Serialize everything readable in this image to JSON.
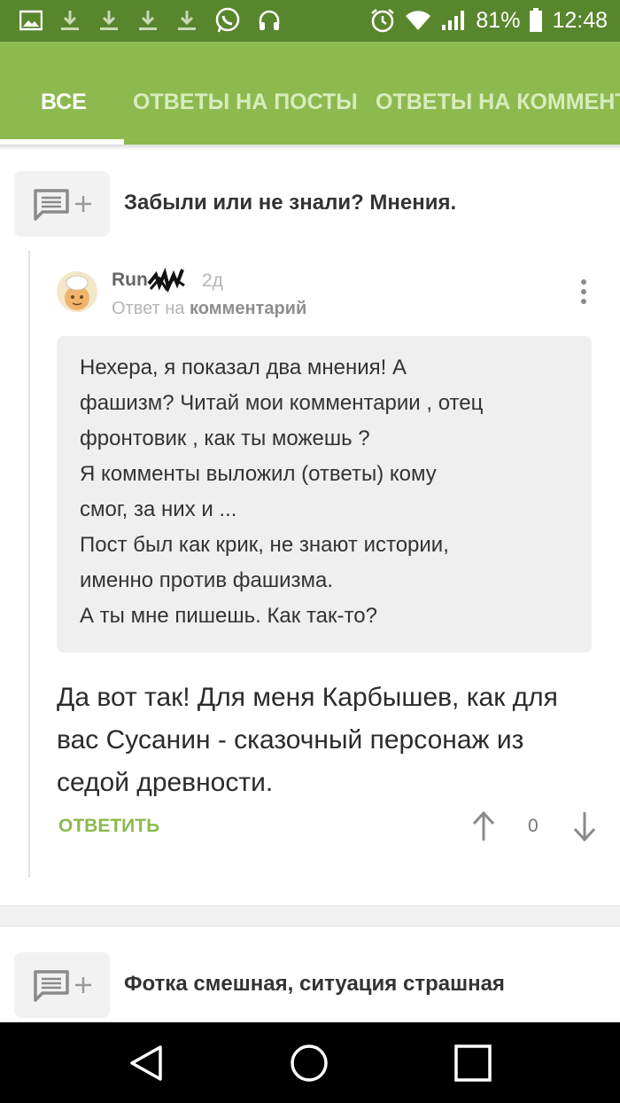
{
  "status_bar": {
    "left_icons": [
      "image-icon",
      "download-icon",
      "download-icon",
      "download-icon",
      "download-icon",
      "whatsapp-icon",
      "headphones-icon"
    ],
    "right_icons": [
      "alarm-icon",
      "wifi-icon",
      "signal-icon"
    ],
    "battery_percent": "81%",
    "time": "12:48"
  },
  "tabs": [
    {
      "label": "ВСЕ",
      "active": true
    },
    {
      "label": "ОТВЕТЫ НА ПОСТЫ",
      "active": false
    },
    {
      "label": "ОТВЕТЫ НА КОММЕНТАРИИ",
      "active": false
    }
  ],
  "posts": [
    {
      "title": "Забыли или не знали? Мнения."
    },
    {
      "title": "Фотка смешная, ситуация страшная"
    }
  ],
  "comment": {
    "username": "Run",
    "time_ago": "2д",
    "reply_prefix": "Ответ на",
    "reply_target": "комментарий",
    "quoted_lines": [
      "Нехера, я показал два мнения! А",
      "фашизм? Читай мои комментарии , отец",
      "фронтовик , как ты можешь ?",
      "Я комменты выложил (ответы) кому",
      "смог, за них и ...",
      "Пост был как крик, не знают истории,",
      "именно против фашизма.",
      "А ты мне пишешь. Как так-то?"
    ],
    "body_lines": [
      "Да вот так! Для меня Карбышев, как для",
      "вас Сусанин - сказочный персонаж из",
      "седой древности."
    ],
    "reply_label": "ОТВЕТИТЬ",
    "rating": "0"
  },
  "nav_bar": {
    "buttons": [
      "back-icon",
      "home-icon",
      "recents-icon"
    ]
  },
  "colors": {
    "status_bar": "#58862d",
    "tab_bar": "#8cba4f",
    "accent_green": "#8cba4f"
  }
}
